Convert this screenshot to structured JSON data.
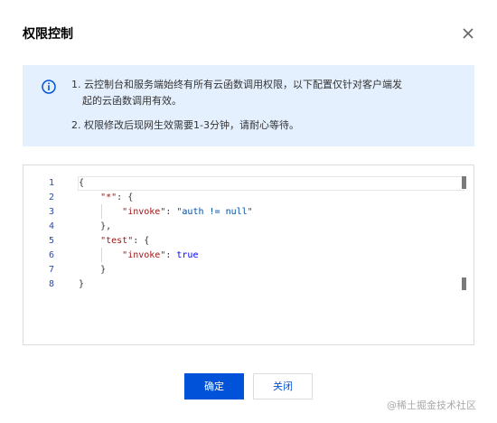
{
  "dialog": {
    "title": "权限控制",
    "close_icon": "close-icon"
  },
  "notice": {
    "icon": "info-icon",
    "line1": "1. 云控制台和服务端始终有所有云函数调用权限，以下配置仅针对客户端发",
    "line1_cont": "起的云函数调用有效。",
    "line2": "2. 权限修改后现网生效需要1-3分钟，请耐心等待。"
  },
  "editor": {
    "line_numbers": [
      "1",
      "2",
      "3",
      "4",
      "5",
      "6",
      "7",
      "8"
    ],
    "lines": [
      [
        {
          "t": "{",
          "c": ""
        }
      ],
      [
        {
          "t": "    ",
          "c": ""
        },
        {
          "t": "\"*\"",
          "c": "key"
        },
        {
          "t": ": {",
          "c": ""
        }
      ],
      [
        {
          "t": "        ",
          "c": ""
        },
        {
          "t": "\"invoke\"",
          "c": "key"
        },
        {
          "t": ": ",
          "c": ""
        },
        {
          "t": "\"auth != null\"",
          "c": "str"
        }
      ],
      [
        {
          "t": "    },",
          "c": ""
        }
      ],
      [
        {
          "t": "    ",
          "c": ""
        },
        {
          "t": "\"test\"",
          "c": "key"
        },
        {
          "t": ": {",
          "c": ""
        }
      ],
      [
        {
          "t": "        ",
          "c": ""
        },
        {
          "t": "\"invoke\"",
          "c": "key"
        },
        {
          "t": ": ",
          "c": ""
        },
        {
          "t": "true",
          "c": "bool"
        }
      ],
      [
        {
          "t": "    }",
          "c": ""
        }
      ],
      [
        {
          "t": "}",
          "c": ""
        }
      ]
    ]
  },
  "buttons": {
    "confirm": "确定",
    "close": "关闭"
  },
  "watermark": "@稀土掘金技术社区",
  "colors": {
    "primary": "#0052d9",
    "notice_bg": "#e5f0ff"
  }
}
